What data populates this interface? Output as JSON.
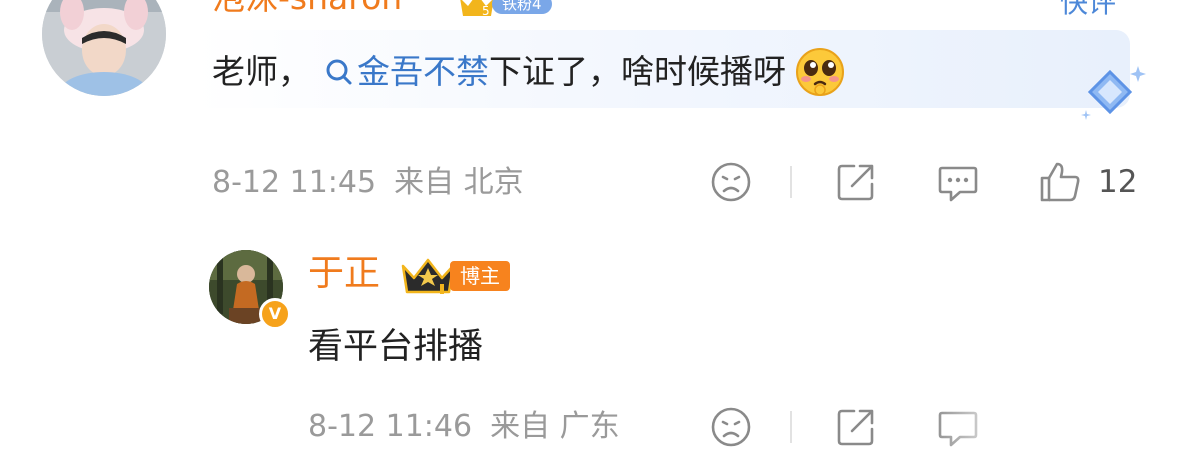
{
  "comment": {
    "username": "泡沫-sharon",
    "level_badge": "铁粉4",
    "level_number": "5",
    "reply_label": "快评",
    "text_prefix": "老师，",
    "topic": "金吾不禁",
    "text_suffix": "下证了，啥时候播呀",
    "emoji": "pleading-face",
    "timestamp": "8-12 11:45",
    "location": "来自 北京",
    "like_count": "12"
  },
  "reply": {
    "username": "于正",
    "role_badge": "博主",
    "verified_mark": "V",
    "text": "看平台排播",
    "timestamp": "8-12 11:46",
    "location": "来自 广东"
  },
  "colors": {
    "username": "#f07b1d",
    "topic_link": "#3a78c9",
    "meta_text": "#9a9a9a",
    "iron_badge": "#7aa7e8",
    "host_badge": "#f7831e"
  }
}
